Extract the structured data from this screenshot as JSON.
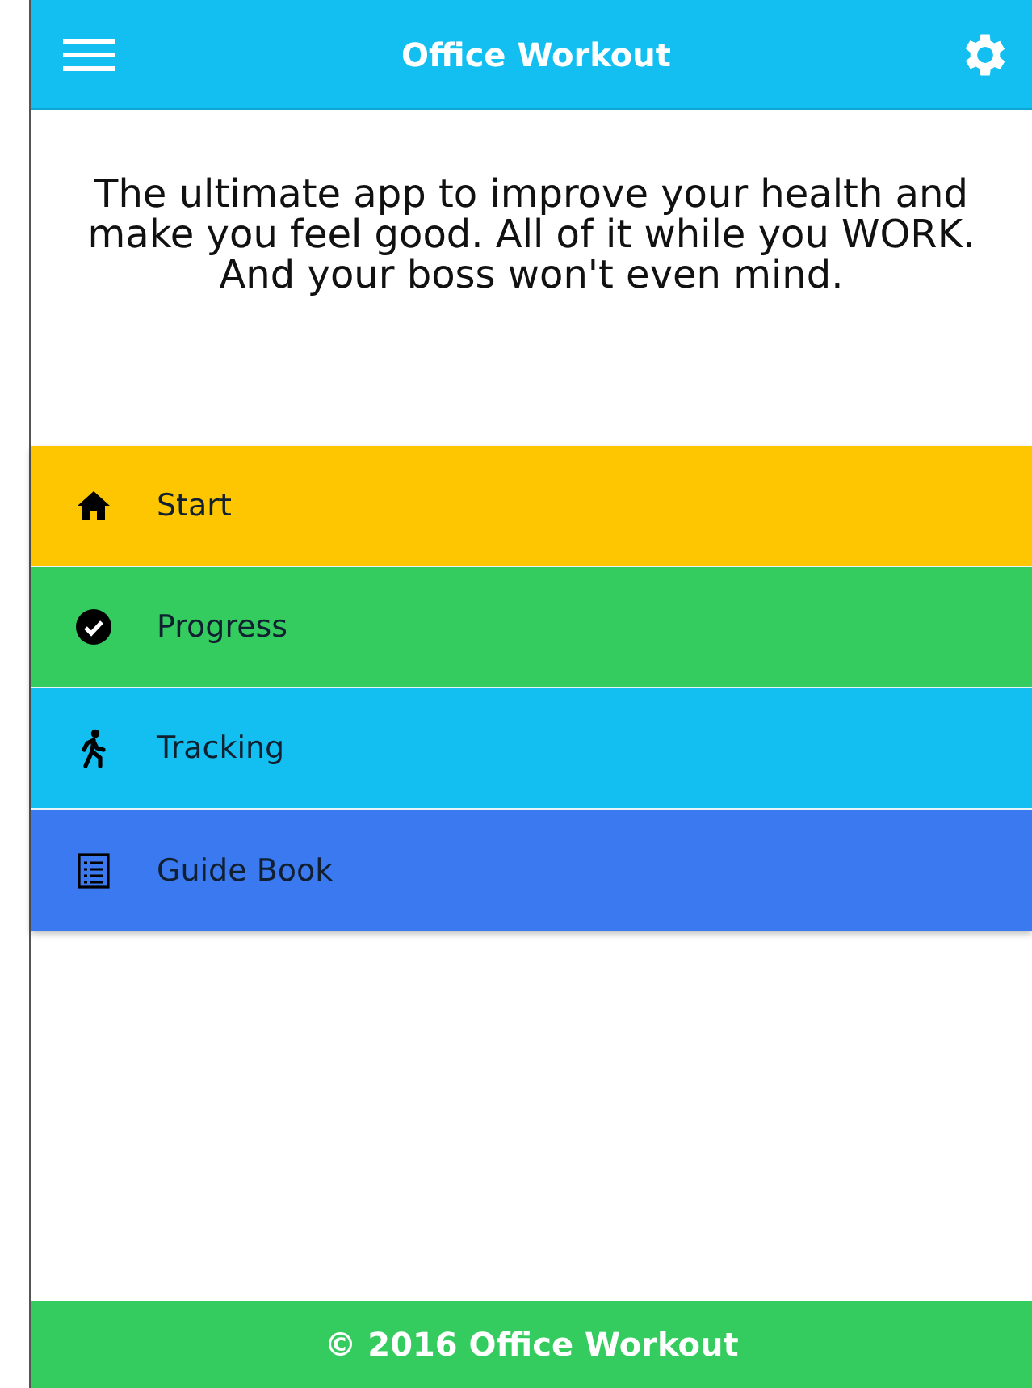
{
  "header": {
    "title": "Office Workout"
  },
  "intro": [
    "The ultimate app to improve your health and make you feel good. All of it while you WORK.",
    "And your boss won't even mind."
  ],
  "menu": [
    {
      "label": "Start",
      "kind": "home",
      "color": "#fdc600"
    },
    {
      "label": "Progress",
      "kind": "check",
      "color": "#34cc5f"
    },
    {
      "label": "Tracking",
      "kind": "walk",
      "color": "#12bff0"
    },
    {
      "label": "Guide Book",
      "kind": "list",
      "color": "#3a79ef"
    }
  ],
  "footer": {
    "text": "© 2016 Office Workout"
  }
}
